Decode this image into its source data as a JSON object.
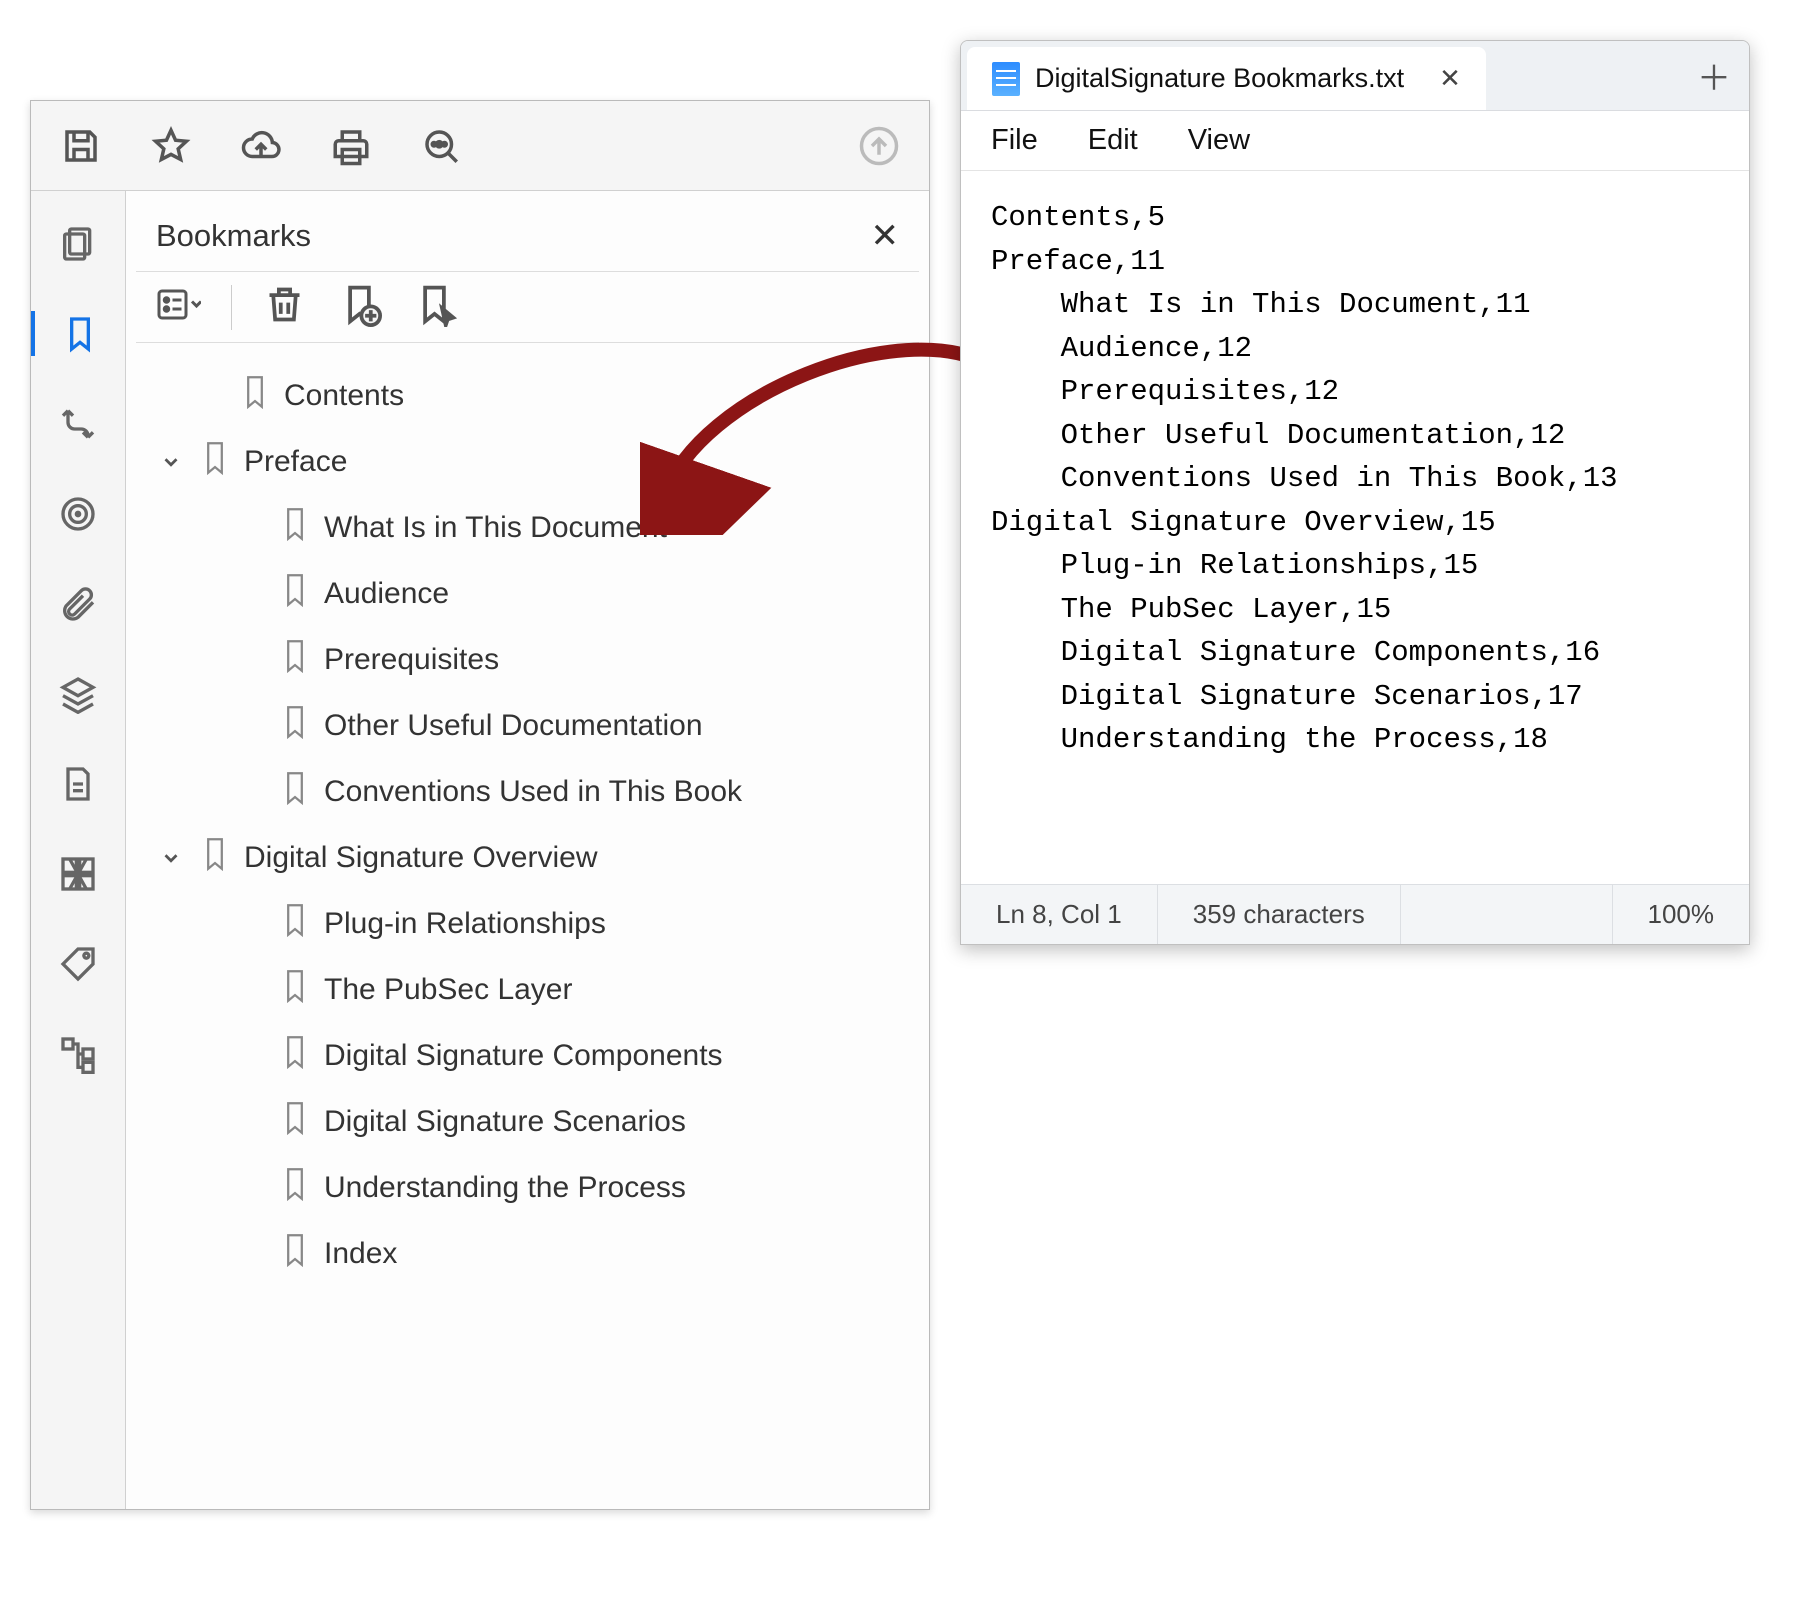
{
  "pdf": {
    "bookmarks_title": "Bookmarks",
    "tree": [
      {
        "label": "Contents",
        "level": 1,
        "expand": ""
      },
      {
        "label": "Preface",
        "level": 0,
        "expand": "v"
      },
      {
        "label": "What Is in This Document",
        "level": 2,
        "expand": ""
      },
      {
        "label": "Audience",
        "level": 2,
        "expand": ""
      },
      {
        "label": "Prerequisites",
        "level": 2,
        "expand": ""
      },
      {
        "label": "Other Useful Documentation",
        "level": 2,
        "expand": ""
      },
      {
        "label": "Conventions Used in This Book",
        "level": 2,
        "expand": ""
      },
      {
        "label": "Digital Signature Overview",
        "level": 0,
        "expand": "v"
      },
      {
        "label": "Plug-in Relationships",
        "level": 2,
        "expand": ""
      },
      {
        "label": "The PubSec Layer",
        "level": 2,
        "expand": ""
      },
      {
        "label": "Digital Signature Components",
        "level": 2,
        "expand": ""
      },
      {
        "label": "Digital Signature Scenarios",
        "level": 2,
        "expand": ""
      },
      {
        "label": "Understanding the Process",
        "level": 2,
        "expand": ""
      },
      {
        "label": "Index",
        "level": 2,
        "expand": ""
      }
    ]
  },
  "notepad": {
    "tab_title": "DigitalSignature Bookmarks.txt",
    "menu": {
      "file": "File",
      "edit": "Edit",
      "view": "View"
    },
    "content": "Contents,5\nPreface,11\n    What Is in This Document,11\n    Audience,12\n    Prerequisites,12\n    Other Useful Documentation,12\n    Conventions Used in This Book,13\nDigital Signature Overview,15\n    Plug-in Relationships,15\n    The PubSec Layer,15\n    Digital Signature Components,16\n    Digital Signature Scenarios,17\n    Understanding the Process,18",
    "status": {
      "pos": "Ln 8, Col 1",
      "chars": "359 characters",
      "zoom": "100%"
    }
  }
}
